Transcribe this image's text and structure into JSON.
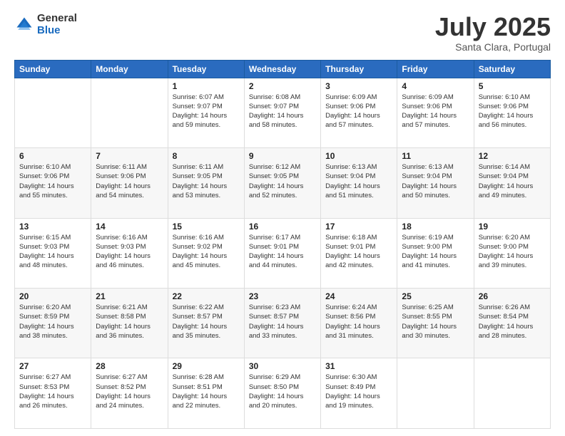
{
  "logo": {
    "general": "General",
    "blue": "Blue"
  },
  "header": {
    "month": "July 2025",
    "location": "Santa Clara, Portugal"
  },
  "weekdays": [
    "Sunday",
    "Monday",
    "Tuesday",
    "Wednesday",
    "Thursday",
    "Friday",
    "Saturday"
  ],
  "weeks": [
    [
      {
        "day": "",
        "info": ""
      },
      {
        "day": "",
        "info": ""
      },
      {
        "day": "1",
        "info": "Sunrise: 6:07 AM\nSunset: 9:07 PM\nDaylight: 14 hours and 59 minutes."
      },
      {
        "day": "2",
        "info": "Sunrise: 6:08 AM\nSunset: 9:07 PM\nDaylight: 14 hours and 58 minutes."
      },
      {
        "day": "3",
        "info": "Sunrise: 6:09 AM\nSunset: 9:06 PM\nDaylight: 14 hours and 57 minutes."
      },
      {
        "day": "4",
        "info": "Sunrise: 6:09 AM\nSunset: 9:06 PM\nDaylight: 14 hours and 57 minutes."
      },
      {
        "day": "5",
        "info": "Sunrise: 6:10 AM\nSunset: 9:06 PM\nDaylight: 14 hours and 56 minutes."
      }
    ],
    [
      {
        "day": "6",
        "info": "Sunrise: 6:10 AM\nSunset: 9:06 PM\nDaylight: 14 hours and 55 minutes."
      },
      {
        "day": "7",
        "info": "Sunrise: 6:11 AM\nSunset: 9:06 PM\nDaylight: 14 hours and 54 minutes."
      },
      {
        "day": "8",
        "info": "Sunrise: 6:11 AM\nSunset: 9:05 PM\nDaylight: 14 hours and 53 minutes."
      },
      {
        "day": "9",
        "info": "Sunrise: 6:12 AM\nSunset: 9:05 PM\nDaylight: 14 hours and 52 minutes."
      },
      {
        "day": "10",
        "info": "Sunrise: 6:13 AM\nSunset: 9:04 PM\nDaylight: 14 hours and 51 minutes."
      },
      {
        "day": "11",
        "info": "Sunrise: 6:13 AM\nSunset: 9:04 PM\nDaylight: 14 hours and 50 minutes."
      },
      {
        "day": "12",
        "info": "Sunrise: 6:14 AM\nSunset: 9:04 PM\nDaylight: 14 hours and 49 minutes."
      }
    ],
    [
      {
        "day": "13",
        "info": "Sunrise: 6:15 AM\nSunset: 9:03 PM\nDaylight: 14 hours and 48 minutes."
      },
      {
        "day": "14",
        "info": "Sunrise: 6:16 AM\nSunset: 9:03 PM\nDaylight: 14 hours and 46 minutes."
      },
      {
        "day": "15",
        "info": "Sunrise: 6:16 AM\nSunset: 9:02 PM\nDaylight: 14 hours and 45 minutes."
      },
      {
        "day": "16",
        "info": "Sunrise: 6:17 AM\nSunset: 9:01 PM\nDaylight: 14 hours and 44 minutes."
      },
      {
        "day": "17",
        "info": "Sunrise: 6:18 AM\nSunset: 9:01 PM\nDaylight: 14 hours and 42 minutes."
      },
      {
        "day": "18",
        "info": "Sunrise: 6:19 AM\nSunset: 9:00 PM\nDaylight: 14 hours and 41 minutes."
      },
      {
        "day": "19",
        "info": "Sunrise: 6:20 AM\nSunset: 9:00 PM\nDaylight: 14 hours and 39 minutes."
      }
    ],
    [
      {
        "day": "20",
        "info": "Sunrise: 6:20 AM\nSunset: 8:59 PM\nDaylight: 14 hours and 38 minutes."
      },
      {
        "day": "21",
        "info": "Sunrise: 6:21 AM\nSunset: 8:58 PM\nDaylight: 14 hours and 36 minutes."
      },
      {
        "day": "22",
        "info": "Sunrise: 6:22 AM\nSunset: 8:57 PM\nDaylight: 14 hours and 35 minutes."
      },
      {
        "day": "23",
        "info": "Sunrise: 6:23 AM\nSunset: 8:57 PM\nDaylight: 14 hours and 33 minutes."
      },
      {
        "day": "24",
        "info": "Sunrise: 6:24 AM\nSunset: 8:56 PM\nDaylight: 14 hours and 31 minutes."
      },
      {
        "day": "25",
        "info": "Sunrise: 6:25 AM\nSunset: 8:55 PM\nDaylight: 14 hours and 30 minutes."
      },
      {
        "day": "26",
        "info": "Sunrise: 6:26 AM\nSunset: 8:54 PM\nDaylight: 14 hours and 28 minutes."
      }
    ],
    [
      {
        "day": "27",
        "info": "Sunrise: 6:27 AM\nSunset: 8:53 PM\nDaylight: 14 hours and 26 minutes."
      },
      {
        "day": "28",
        "info": "Sunrise: 6:27 AM\nSunset: 8:52 PM\nDaylight: 14 hours and 24 minutes."
      },
      {
        "day": "29",
        "info": "Sunrise: 6:28 AM\nSunset: 8:51 PM\nDaylight: 14 hours and 22 minutes."
      },
      {
        "day": "30",
        "info": "Sunrise: 6:29 AM\nSunset: 8:50 PM\nDaylight: 14 hours and 20 minutes."
      },
      {
        "day": "31",
        "info": "Sunrise: 6:30 AM\nSunset: 8:49 PM\nDaylight: 14 hours and 19 minutes."
      },
      {
        "day": "",
        "info": ""
      },
      {
        "day": "",
        "info": ""
      }
    ]
  ]
}
